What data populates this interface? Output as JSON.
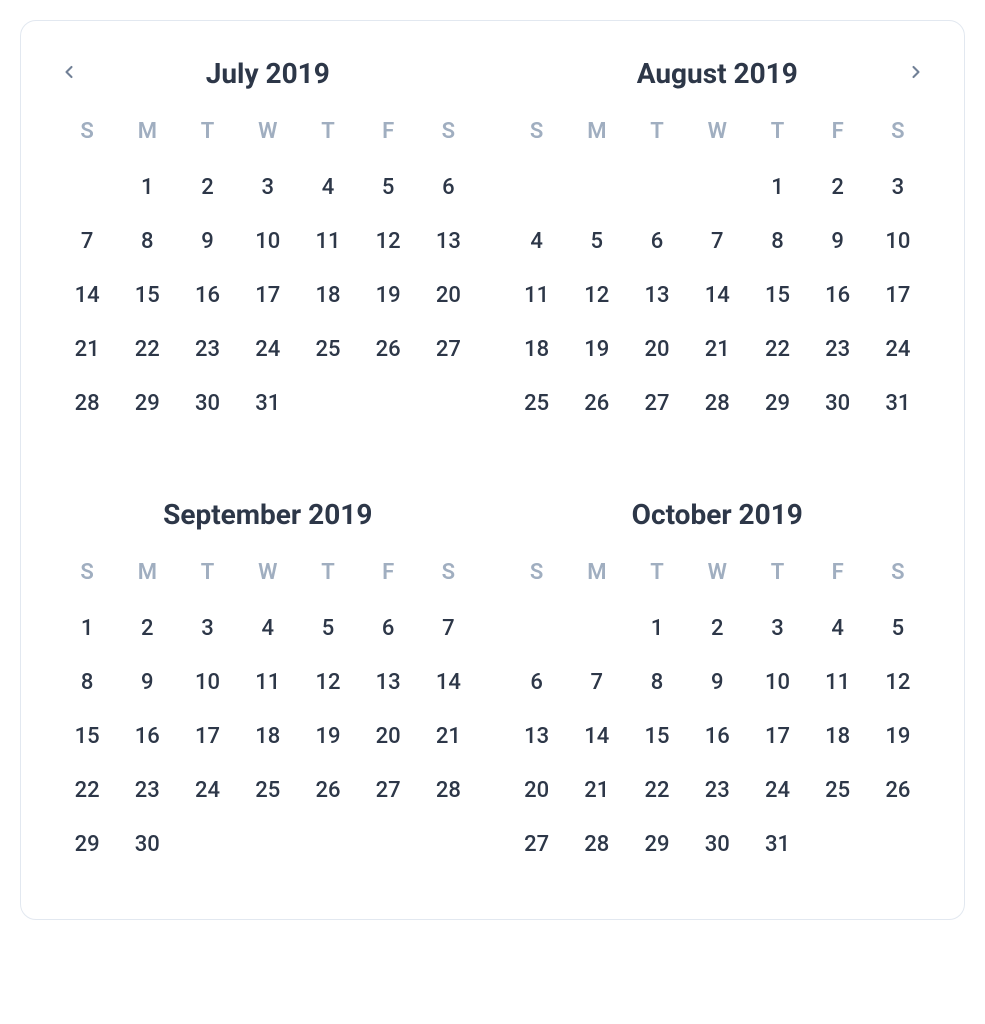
{
  "weekdays": [
    "S",
    "M",
    "T",
    "W",
    "T",
    "F",
    "S"
  ],
  "months": [
    {
      "title": "July 2019",
      "offset": 1,
      "days": 31,
      "nav": "prev"
    },
    {
      "title": "August 2019",
      "offset": 4,
      "days": 31,
      "nav": "next"
    },
    {
      "title": "September 2019",
      "offset": 0,
      "days": 30,
      "nav": null
    },
    {
      "title": "October 2019",
      "offset": 2,
      "days": 31,
      "nav": null
    }
  ]
}
